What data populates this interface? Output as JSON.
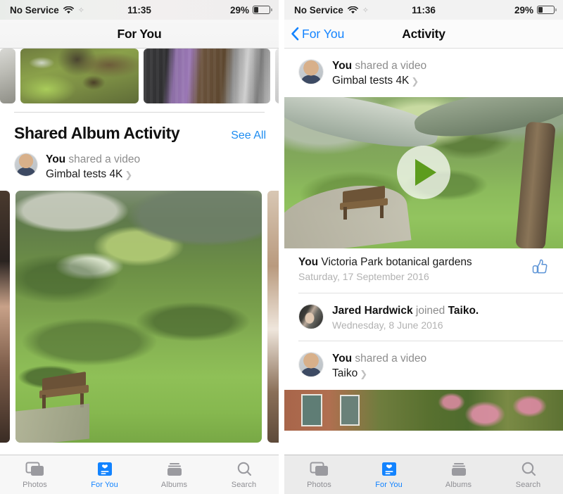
{
  "left": {
    "status": {
      "carrier": "No Service",
      "wifi_icon": "wifi-icon",
      "sync_icon": "sync-icon",
      "time": "11:35",
      "battery_percent": "29%",
      "battery_icon": "battery-icon"
    },
    "nav": {
      "title": "For You"
    },
    "section": {
      "title": "Shared Album Activity",
      "see_all": "See All"
    },
    "activity": {
      "actor": "You",
      "action": " shared a video",
      "album": "Gimbal tests 4K",
      "chevron_icon": "chevron-right-icon",
      "avatar_icon": "avatar"
    },
    "tabs": [
      {
        "label": "Photos",
        "icon": "photos-icon",
        "active": false
      },
      {
        "label": "For You",
        "icon": "for-you-icon",
        "active": true
      },
      {
        "label": "Albums",
        "icon": "albums-icon",
        "active": false
      },
      {
        "label": "Search",
        "icon": "search-icon",
        "active": false
      }
    ]
  },
  "right": {
    "status": {
      "carrier": "No Service",
      "wifi_icon": "wifi-icon",
      "sync_icon": "sync-icon",
      "time": "11:36",
      "battery_percent": "29%",
      "battery_icon": "battery-icon"
    },
    "nav": {
      "back_label": "For You",
      "back_icon": "chevron-left-icon",
      "title": "Activity"
    },
    "feed": [
      {
        "actor": "You",
        "action": " shared a video",
        "album": "Gimbal tests 4K",
        "chevron_icon": "chevron-right-icon",
        "has_media": true,
        "play_icon": "play-icon",
        "caption_actor": "You",
        "caption_text": " Victoria Park botanical gardens",
        "caption_date": "Saturday, 17 September 2016",
        "like_icon": "thumbs-up-icon"
      },
      {
        "actor": "Jared Hardwick",
        "action": " joined ",
        "album": "Taiko.",
        "date": "Wednesday, 8 June 2016",
        "has_media": false
      },
      {
        "actor": "You",
        "action": " shared a video",
        "album": "Taiko",
        "chevron_icon": "chevron-right-icon",
        "has_media": true
      }
    ],
    "tabs": [
      {
        "label": "Photos",
        "icon": "photos-icon",
        "active": false
      },
      {
        "label": "For You",
        "icon": "for-you-icon",
        "active": true
      },
      {
        "label": "Albums",
        "icon": "albums-icon",
        "active": false
      },
      {
        "label": "Search",
        "icon": "search-icon",
        "active": false
      }
    ]
  },
  "colors": {
    "accent": "#1283ff",
    "link": "#1e8cf0",
    "secondary_text": "#8c8c8c",
    "date_text": "#b2b2b2",
    "tab_inactive": "#8e8e93",
    "play_green": "#5d9c1d"
  }
}
